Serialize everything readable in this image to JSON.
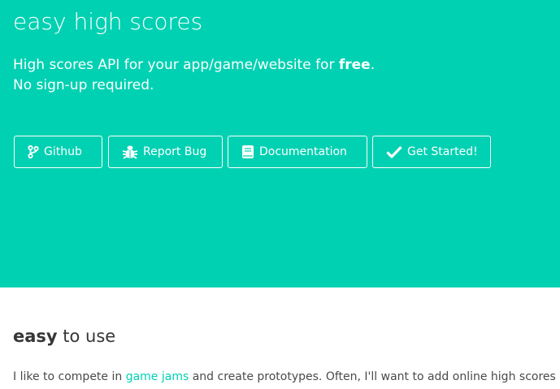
{
  "hero": {
    "title": "easy high scores",
    "subtitle_line1_prefix": "High scores API for your app/game/website for ",
    "subtitle_line1_bold": "free",
    "subtitle_line1_suffix": ".",
    "subtitle_line2": "No sign-up required.",
    "background": "#00d1b2"
  },
  "buttons": [
    {
      "label": "Github",
      "icon": "branch-icon"
    },
    {
      "label": "Report Bug",
      "icon": "bug-icon"
    },
    {
      "label": "Documentation",
      "icon": "book-icon"
    },
    {
      "label": "Get Started!",
      "icon": "checkmark-icon"
    }
  ],
  "section": {
    "title_bold": "easy",
    "title_rest": " to use",
    "text_prefix": "I like to compete in ",
    "text_link": "game jams",
    "text_suffix": " and create prototypes. Often, I'll want to add online high scores",
    "link_color": "#00d1b2"
  }
}
